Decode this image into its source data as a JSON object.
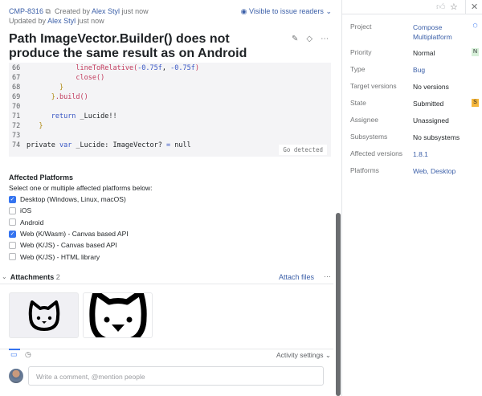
{
  "issue": {
    "id": "CMP-8316",
    "created_prefix": "Created by",
    "author": "Alex Styl",
    "created_time": "just now",
    "updated_prefix": "Updated by",
    "updated_by": "Alex Styl",
    "updated_time": "just now",
    "visibility": "Visible to issue readers",
    "title": "Path ImageVector.Builder() does not produce the same result as on Android"
  },
  "code": {
    "language_badge": "Go detected",
    "lines": [
      {
        "n": "66",
        "indent": "            ",
        "parts": [
          {
            "t": "lineToRelative(",
            "c": "fn"
          },
          {
            "t": "-0.75f",
            "c": "num"
          },
          {
            "t": ", ",
            "c": ""
          },
          {
            "t": "-0.75f",
            "c": "num"
          },
          {
            "t": ")",
            "c": "fn"
          }
        ]
      },
      {
        "n": "67",
        "indent": "            ",
        "parts": [
          {
            "t": "close()",
            "c": "fn"
          }
        ]
      },
      {
        "n": "68",
        "indent": "        ",
        "parts": [
          {
            "t": "}",
            "c": "br"
          }
        ]
      },
      {
        "n": "69",
        "indent": "      ",
        "parts": [
          {
            "t": "}",
            "c": "br"
          },
          {
            "t": ".build()",
            "c": "fn"
          }
        ]
      },
      {
        "n": "70",
        "indent": "",
        "parts": []
      },
      {
        "n": "71",
        "indent": "      ",
        "parts": [
          {
            "t": "return ",
            "c": "kw"
          },
          {
            "t": "_Lucide!!",
            "c": ""
          }
        ]
      },
      {
        "n": "72",
        "indent": "   ",
        "parts": [
          {
            "t": "}",
            "c": "br"
          }
        ]
      },
      {
        "n": "73",
        "indent": "",
        "parts": []
      },
      {
        "n": "74",
        "indent": "",
        "parts": [
          {
            "t": "private ",
            "c": ""
          },
          {
            "t": "var ",
            "c": "kw"
          },
          {
            "t": "_Lucide: ImageVector? ",
            "c": ""
          },
          {
            "t": "=",
            "c": "kw"
          },
          {
            "t": " null",
            "c": ""
          }
        ]
      }
    ]
  },
  "platforms": {
    "heading": "Affected Platforms",
    "subtitle": "Select one or multiple affected platforms below:",
    "options": [
      {
        "label": "Desktop (Windows, Linux, macOS)",
        "checked": true
      },
      {
        "label": "iOS",
        "checked": false
      },
      {
        "label": "Android",
        "checked": false
      },
      {
        "label": "Web (K/Wasm) - Canvas based API",
        "checked": true
      },
      {
        "label": "Web (K/JS) - Canvas based API",
        "checked": false
      },
      {
        "label": "Web (K/JS) - HTML library",
        "checked": false
      }
    ]
  },
  "attachments": {
    "label": "Attachments",
    "count": "2",
    "attach_label": "Attach files"
  },
  "activity": {
    "settings_label": "Activity settings",
    "comment_placeholder": "Write a comment, @mention people"
  },
  "fields": [
    {
      "key": "Project",
      "value": "Compose Multiplatform",
      "link": true
    },
    {
      "key": "Priority",
      "value": "Normal",
      "badge": "N",
      "badge_color": "#d7f0d9"
    },
    {
      "key": "Type",
      "value": "Bug",
      "link": true
    },
    {
      "key": "Target versions",
      "value": "No versions"
    },
    {
      "key": "State",
      "value": "Submitted",
      "badge": "S",
      "badge_color": "#f6b73c"
    },
    {
      "key": "Assignee",
      "value": "Unassigned"
    },
    {
      "key": "Subsystems",
      "value": "No subsystems"
    },
    {
      "key": "Affected versions",
      "value": "1.8.1",
      "link": true
    },
    {
      "key": "Platforms",
      "value": "Web, Desktop",
      "link": true
    }
  ]
}
